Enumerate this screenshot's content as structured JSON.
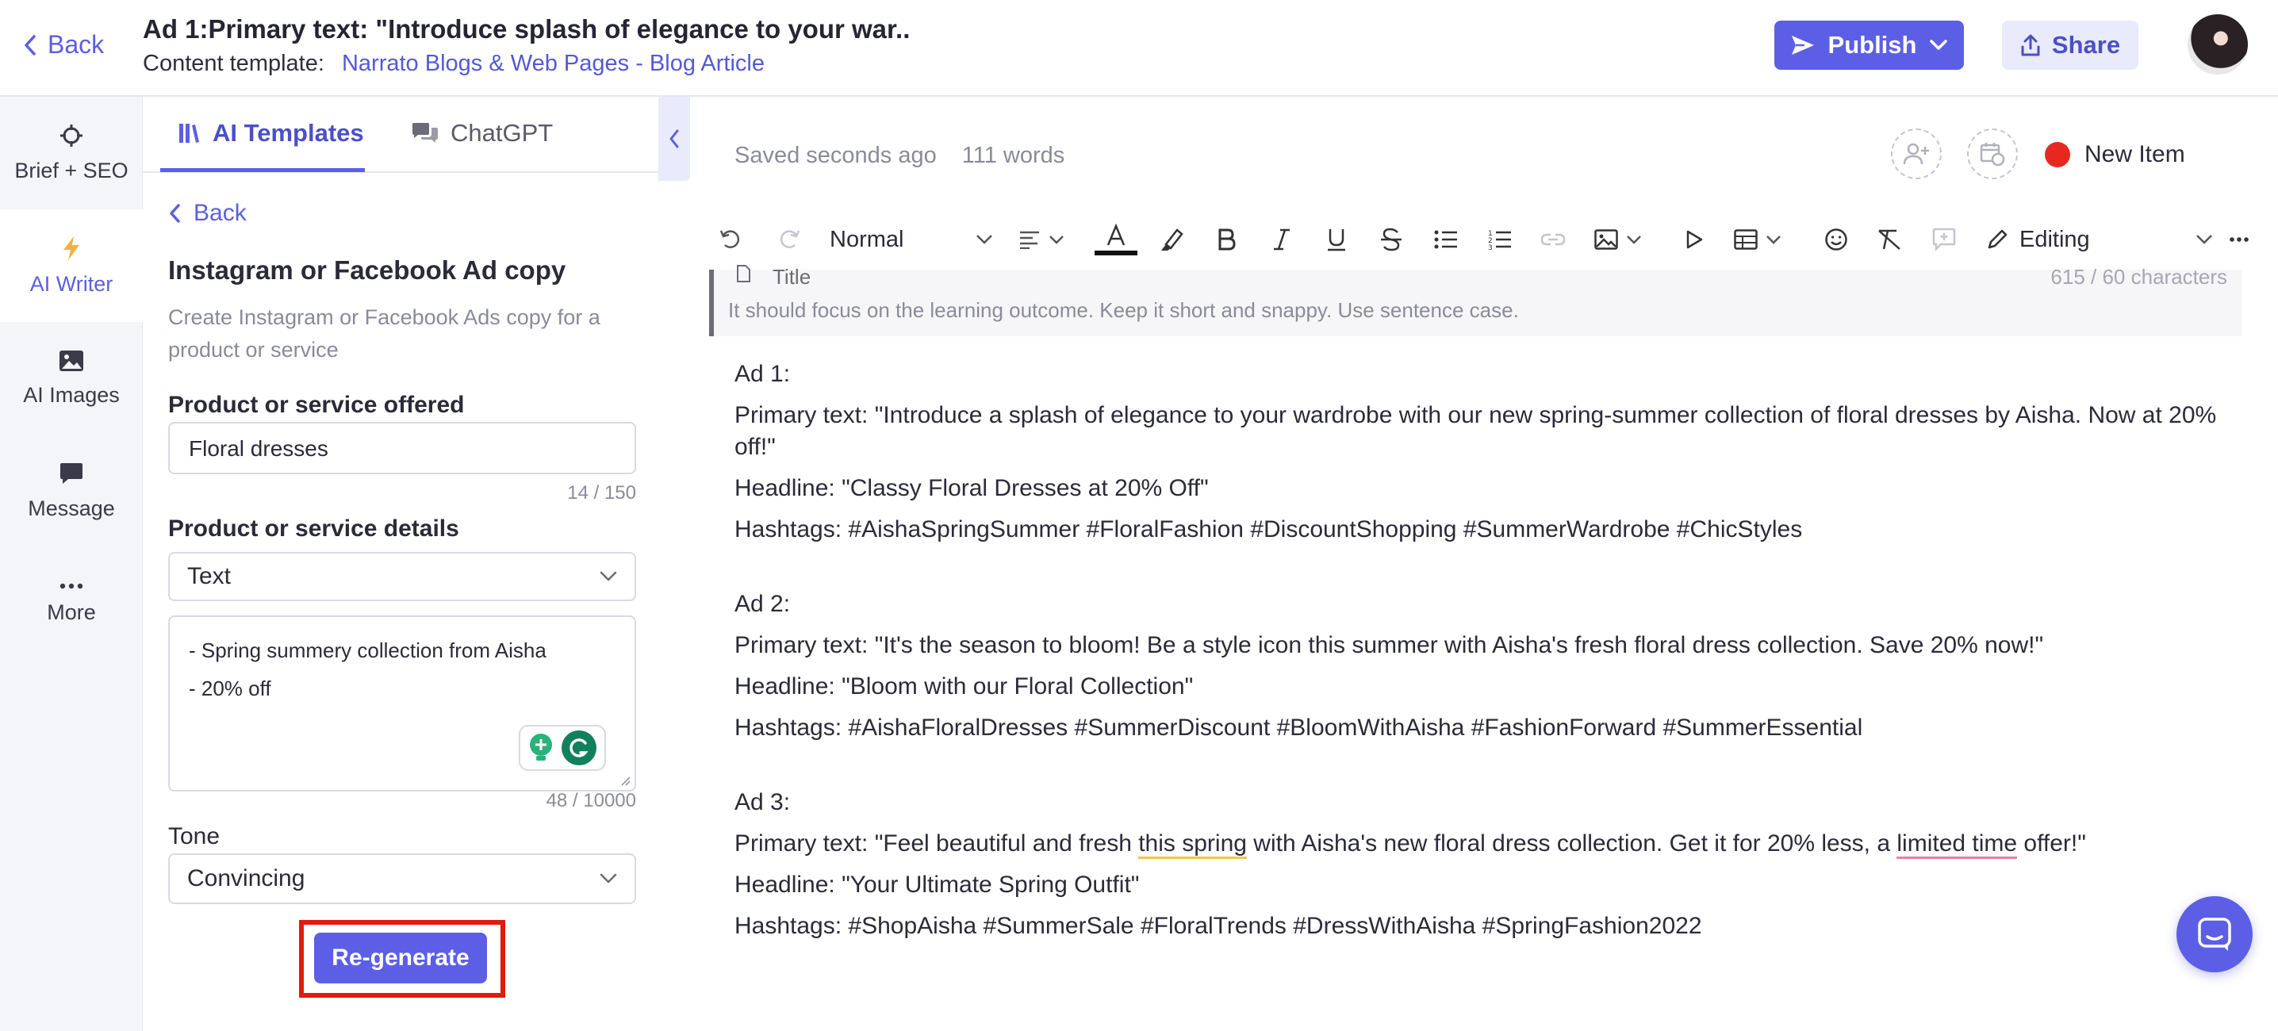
{
  "header": {
    "back_label": "Back",
    "title": "Ad 1:Primary text: \"Introduce splash of elegance to your war..",
    "template_label": "Content template:",
    "template_link": "Narrato Blogs & Web Pages - Blog Article",
    "publish_label": "Publish",
    "share_label": "Share"
  },
  "leftnav": {
    "items": [
      {
        "label": "Brief + SEO",
        "icon": "crosshair-icon"
      },
      {
        "label": "AI Writer",
        "icon": "lightning-icon"
      },
      {
        "label": "AI Images",
        "icon": "image-icon"
      },
      {
        "label": "Message",
        "icon": "message-icon"
      },
      {
        "label": "More",
        "icon": "more-icon"
      }
    ]
  },
  "panel": {
    "tabs": [
      {
        "label": "AI Templates"
      },
      {
        "label": "ChatGPT"
      }
    ],
    "back_label": "Back",
    "heading": "Instagram or Facebook Ad copy",
    "description": "Create Instagram or Facebook Ads copy for a product or service",
    "product_label": "Product or service offered",
    "product_value": "Floral dresses",
    "product_counter": "14 / 150",
    "details_label": "Product or service details",
    "details_type": "Text",
    "details_line1": "- Spring summery collection from Aisha",
    "details_line2": "- 20% off",
    "details_counter": "48 / 10000",
    "tone_label": "Tone",
    "tone_value": "Convincing",
    "regenerate_label": "Re-generate"
  },
  "editor": {
    "saved_status": "Saved seconds ago",
    "word_count": "111 words",
    "new_item_label": "New Item",
    "toolbar": {
      "style_value": "Normal",
      "mode_value": "Editing"
    },
    "title_field": {
      "label": "Title",
      "char_count": "615 / 60 characters",
      "hint": "It should focus on the learning outcome. Keep it short and snappy. Use sentence case."
    },
    "ads": [
      {
        "heading": "Ad 1:",
        "primary": "Primary text: \"Introduce a splash of elegance to your wardrobe with our new spring-summer collection of floral dresses by Aisha. Now at 20% off!\"",
        "headline": "Headline: \"Classy Floral Dresses at 20% Off\"",
        "hashtags": "Hashtags: #AishaSpringSummer #FloralFashion #DiscountShopping #SummerWardrobe #ChicStyles"
      },
      {
        "heading": "Ad 2:",
        "primary": "Primary text: \"It's the season to bloom! Be a style icon this summer with Aisha's fresh floral dress collection. Save 20% now!\"",
        "headline": "Headline: \"Bloom with our Floral Collection\"",
        "hashtags": "Hashtags: #AishaFloralDresses #SummerDiscount #BloomWithAisha #FashionForward #SummerEssential"
      },
      {
        "heading": "Ad 3:",
        "primary_part1": "Primary text: \"Feel beautiful and fresh ",
        "primary_underline1": "this spring",
        "primary_part2": " with Aisha's new floral dress collection. Get it for 20% less, a ",
        "primary_underline2": "limited time",
        "primary_part3": " offer!\"",
        "headline": "Headline: \"Your Ultimate Spring Outfit\"",
        "hashtags": "Hashtags: #ShopAisha #SummerSale #FloralTrends #DressWithAisha #SpringFashion2022"
      }
    ]
  },
  "colors": {
    "accent": "#5c5fe6",
    "highlight_outline": "#e01b0f",
    "status_dot": "#e8281f"
  }
}
